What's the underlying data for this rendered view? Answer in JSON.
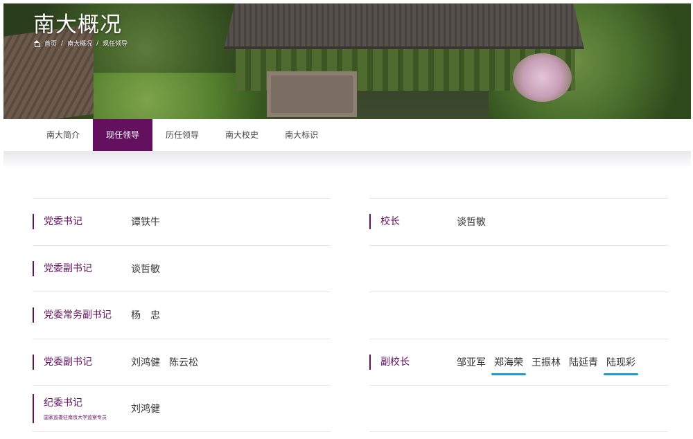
{
  "hero": {
    "title": "南大概况",
    "breadcrumb": [
      "首页",
      "/",
      "南大概况",
      "/",
      "现任领导"
    ]
  },
  "tabs": [
    "南大简介",
    "现任领导",
    "历任领导",
    "南大校史",
    "南大标识"
  ],
  "active_tab": "现任领导",
  "accent_color": "#63105f",
  "highlight_color": "#1a9ae0",
  "left_rows": [
    {
      "role": "党委书记",
      "names": [
        "谭铁牛"
      ]
    },
    {
      "role": "党委副书记",
      "names": [
        "谈哲敏"
      ]
    },
    {
      "role": "党委常务副书记",
      "names": [
        "杨　忠"
      ]
    },
    {
      "role": "党委副书记",
      "names": [
        "刘鸿健",
        "陈云松"
      ]
    },
    {
      "role": "纪委书记",
      "sub": "国家监委驻南京大学监察专员",
      "names": [
        "刘鸿健"
      ]
    }
  ],
  "right_rows": [
    {
      "role": "校长",
      "names": [
        "谈哲敏"
      ]
    },
    {
      "role": "副校长",
      "names": [
        "邹亚军",
        "郑海荣",
        "王振林",
        "陆延青",
        "陆现彩"
      ],
      "highlighted": [
        "郑海荣",
        "陆现彩"
      ]
    }
  ]
}
